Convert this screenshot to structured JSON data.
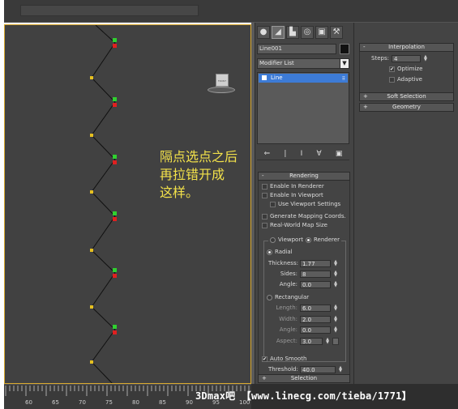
{
  "annotation": "隔点选点之后\n再拉错开成\n这样。",
  "viewcube_label": "FRONT",
  "command_panel": {
    "tab_icons": [
      "create-icon",
      "modify-icon",
      "hierarchy-icon",
      "motion-icon",
      "display-icon",
      "utilities-icon"
    ],
    "object_name": "Line001",
    "object_color": "#111111",
    "modifier_list": "Modifier List",
    "stack_items": [
      "Line"
    ],
    "stack_tool_icons": [
      "pin-stack-icon",
      "show-end-result-icon",
      "make-unique-icon",
      "remove-modifier-icon",
      "configure-sets-icon"
    ]
  },
  "rendering": {
    "title": "Rendering",
    "enable_in_renderer": "Enable In Renderer",
    "enable_in_viewport": "Enable In Viewport",
    "use_viewport_settings": "Use Viewport Settings",
    "generate_mapping": "Generate Mapping Coords.",
    "real_world_map": "Real-World Map Size",
    "viewport_label": "Viewport",
    "renderer_label": "Renderer",
    "radial_label": "Radial",
    "thickness_label": "Thickness:",
    "thickness_value": "1.77",
    "sides_label": "Sides:",
    "sides_value": "8",
    "angle_label": "Angle:",
    "angle_value": "0.0",
    "rectangular_label": "Rectangular",
    "length_label": "Length:",
    "length_value": "6.0",
    "width_label": "Width:",
    "width_value": "2.0",
    "angle2_label": "Angle:",
    "angle2_value": "0.0",
    "aspect_label": "Aspect:",
    "aspect_value": "3.0",
    "auto_smooth": "Auto Smooth",
    "threshold_label": "Threshold:",
    "threshold_value": "40.0"
  },
  "selection_title": "Selection",
  "interpolation": {
    "title": "Interpolation",
    "steps_label": "Steps:",
    "steps_value": "4",
    "optimize": "Optimize",
    "adaptive": "Adaptive"
  },
  "soft_selection_title": "Soft Selection",
  "geometry_title": "Geometry",
  "timeline_ticks": [
    "60",
    "65",
    "70",
    "75",
    "80",
    "85",
    "90",
    "95",
    "100"
  ],
  "watermark": "3Dmax吧 【www.linecg.com/tieba/1771】"
}
